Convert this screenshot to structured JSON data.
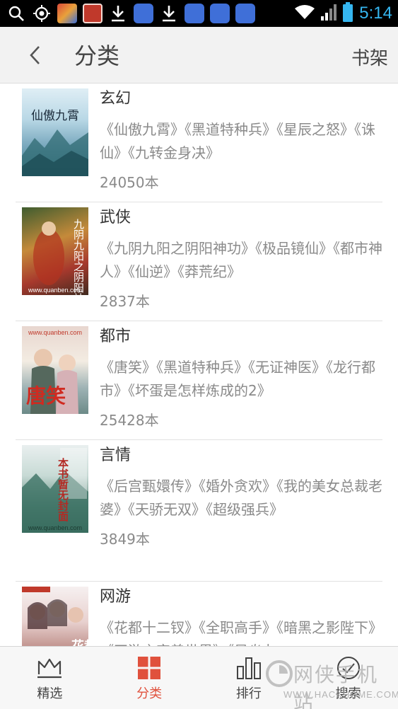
{
  "status_bar": {
    "time": "5:14",
    "colors": {
      "background": "#000000",
      "time": "#35b6f0"
    }
  },
  "header": {
    "title": "分类",
    "shelf_label": "书架"
  },
  "categories": [
    {
      "name": "玄幻",
      "books": "《仙傲九霄》《黑道特种兵》《星辰之怒》《诛仙》《九转金身决》",
      "count": "24050本",
      "cover_text": "仙傲九霄"
    },
    {
      "name": "武侠",
      "books": "《九阴九阳之阴阳神功》《极品镜仙》《都市神人》《仙逆》《莽荒纪》",
      "count": "2837本",
      "cover_text": "九阴九阳之阴阳神功",
      "cover_site": "www.quanben.com"
    },
    {
      "name": "都市",
      "books": "《唐笑》《黑道特种兵》《无证神医》《龙行都市》《坏蛋是怎样炼成的2》",
      "count": "25428本",
      "cover_text": "唐笑",
      "cover_site": "www.quanben.com"
    },
    {
      "name": "言情",
      "books": "《后宫甄嬛传》《婚外贪欢》《我的美女总裁老婆》《天骄无双》《超级强兵》",
      "count": "3849本",
      "cover_text": "本书暂无封面",
      "cover_site": "www.quanben.com"
    },
    {
      "name": "网游",
      "books": "《花都十二钗》《全职高手》《暗黑之影陛下》《网游之字善世界》《星炎丸",
      "count": "",
      "cover_text": "花都"
    }
  ],
  "bottom_nav": {
    "items": [
      {
        "label": "精选",
        "icon": "crown-icon",
        "active": false
      },
      {
        "label": "分类",
        "icon": "grid-icon",
        "active": true
      },
      {
        "label": "排行",
        "icon": "bar-chart-icon",
        "active": false
      },
      {
        "label": "搜索",
        "icon": "compass-icon",
        "active": false
      }
    ],
    "colors": {
      "active": "#e0513d",
      "inactive": "#444444"
    }
  },
  "watermark": {
    "title": "网侠手机站",
    "url": "WWW.HACKHOME.COM"
  }
}
